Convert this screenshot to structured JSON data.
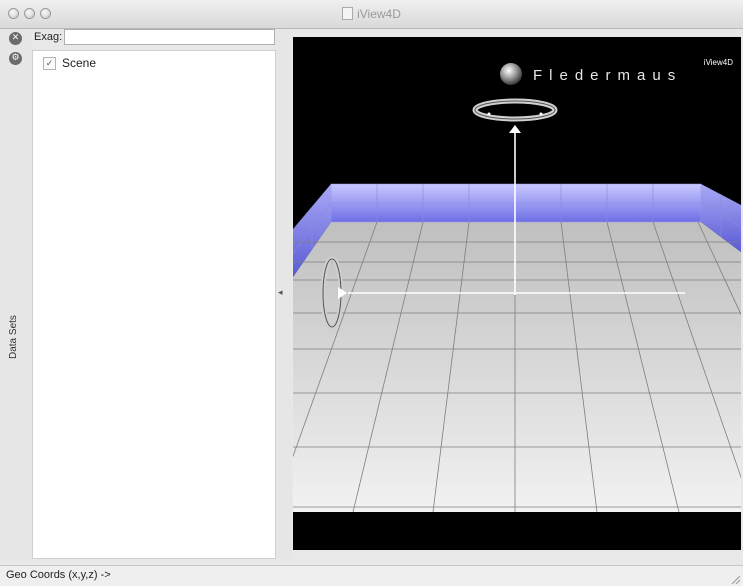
{
  "window": {
    "title": "iView4D"
  },
  "sidebar": {
    "exag_label": "Exag:",
    "exag_value": "",
    "tab_label": "Data Sets",
    "tree_items": [
      {
        "label": "Scene",
        "checked": true
      }
    ]
  },
  "viewer": {
    "logo_text": "Fledermaus",
    "logo_subtitle": "iView4D"
  },
  "status_bar": {
    "text": "Geo Coords (x,y,z) ->"
  }
}
